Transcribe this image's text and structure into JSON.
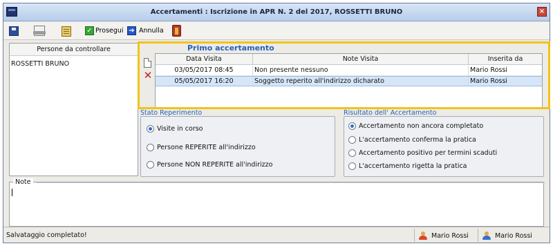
{
  "window": {
    "title": "Accertamenti : Iscrizione in APR N. 2 del 2017, ROSSETTI BRUNO",
    "close_symbol": "×"
  },
  "toolbar": {
    "save_label": "Prosegui",
    "cancel_label": "Annulla",
    "check_symbol": "✓",
    "arrow_symbol": "➔"
  },
  "persons": {
    "header": "Persone da controllare",
    "items": [
      "ROSSETTI BRUNO"
    ]
  },
  "visits": {
    "title": "Primo accertamento",
    "columns": [
      "Data Visita",
      "Note Visita",
      "Inserita da"
    ],
    "rows": [
      [
        "03/05/2017 08:45",
        "Non presente nessuno",
        "Mario Rossi"
      ],
      [
        "05/05/2017 16:20",
        "Soggetto reperito all'indirizzo dicharato",
        "Mario Rossi"
      ]
    ],
    "selected_row": 1,
    "delete_symbol": "✕"
  },
  "stato": {
    "label": "Stato Reperimento",
    "options": [
      "Visite in corso",
      "Persone REPERITE all'indirizzo",
      "Persone NON REPERITE all'indirizzo"
    ],
    "selected": 0
  },
  "risultato": {
    "label": "Risultato dell' Accertamento",
    "options": [
      "Accertamento non ancora completato",
      "L'accertamento conferma la pratica",
      "Accertamento positivo per termini scaduti",
      "L'accertamento rigetta la pratica"
    ],
    "selected": 0
  },
  "notes": {
    "label": "Note",
    "value": ""
  },
  "status": {
    "message": "Salvataggio completato!",
    "user1": "Mario Rossi",
    "user2": "Mario Rossi"
  },
  "colors": {
    "highlight": "#f2c318",
    "accent": "#2861b8",
    "selection": "#d6e6f8"
  }
}
